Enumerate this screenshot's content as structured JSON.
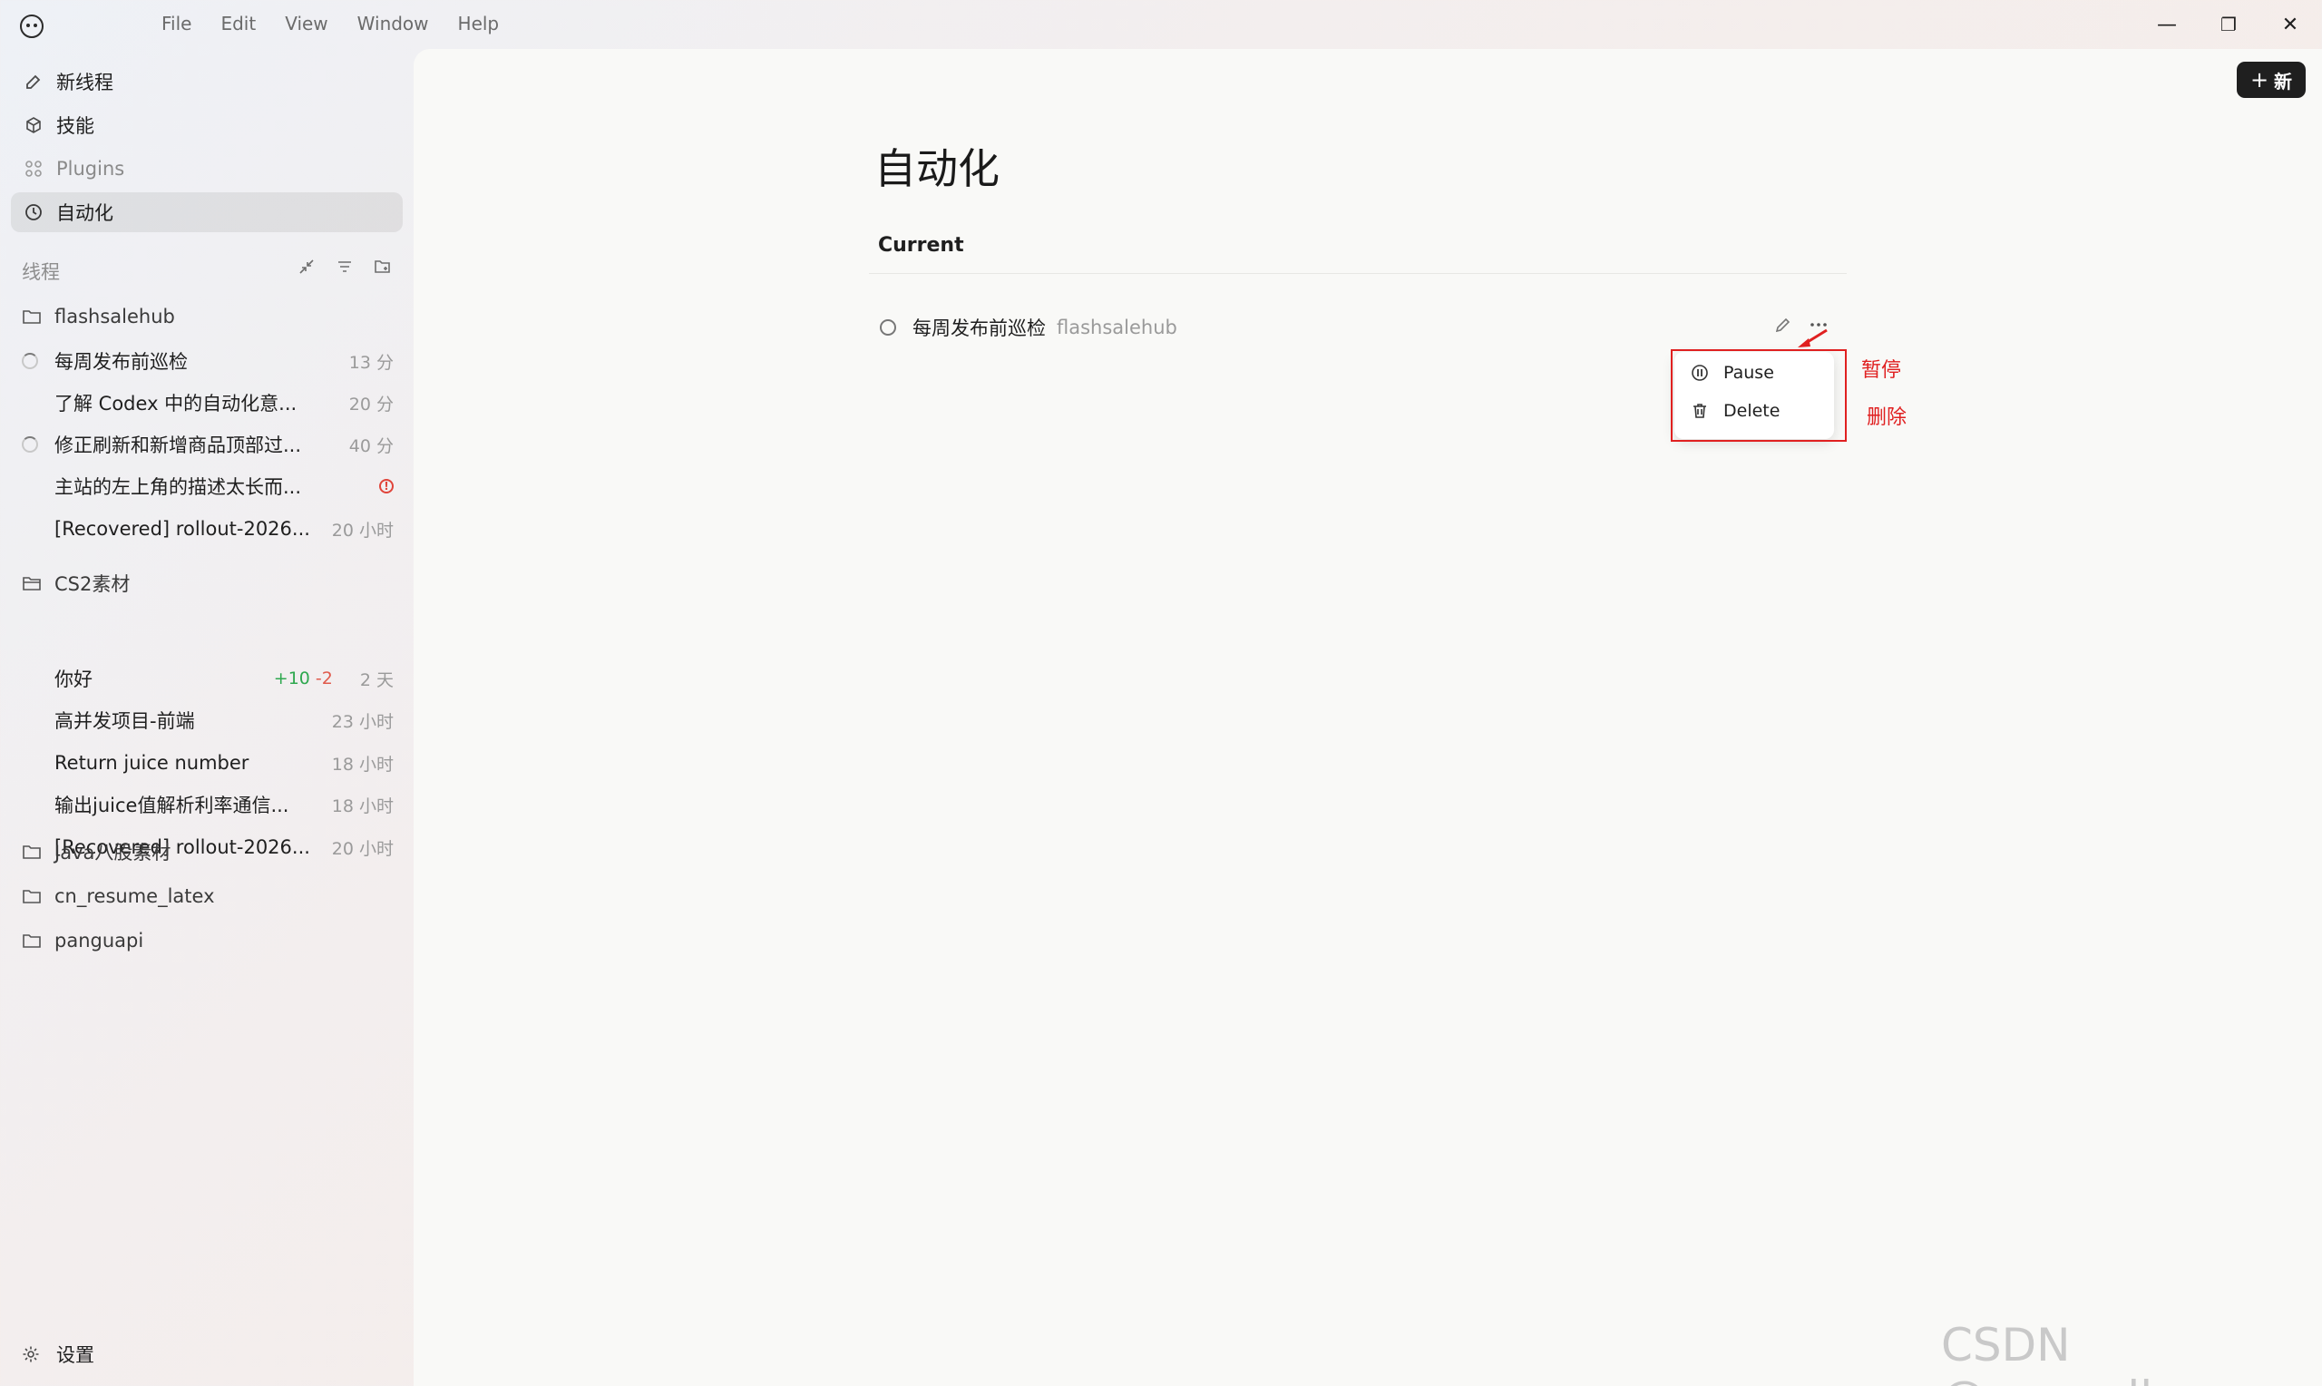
{
  "menu": [
    "File",
    "Edit",
    "View",
    "Window",
    "Help"
  ],
  "window_controls": {
    "minimize": "—",
    "restore": "❐",
    "close": "✕"
  },
  "nav": {
    "new_thread": "新线程",
    "skills": "技能",
    "plugins": "Plugins",
    "automation": "自动化"
  },
  "threads_section": {
    "label": "线程"
  },
  "folders": [
    {
      "name": "flashsalehub",
      "threads": [
        {
          "title": "每周发布前巡检",
          "time": "13 分",
          "lead": "spinner"
        },
        {
          "title": "了解 Codex 中的自动化意...",
          "time": "20 分",
          "lead": ""
        },
        {
          "title": "修正刷新和新增商品顶部过...",
          "time": "40 分",
          "lead": "spinner"
        },
        {
          "title": "主站的左上角的描述太长而...",
          "time": "",
          "lead": "",
          "status": "!"
        },
        {
          "title": "[Recovered] rollout-2026...",
          "time": "20 小时",
          "lead": ""
        }
      ]
    },
    {
      "name": "CS2素材",
      "threads": [
        {
          "title": "你好",
          "time": "2 天",
          "lead": "",
          "added": "+10",
          "removed": "-2"
        },
        {
          "title": "高并发项目-前端",
          "time": "23 小时",
          "lead": ""
        },
        {
          "title": "Return juice number",
          "time": "18 小时",
          "lead": ""
        },
        {
          "title": "输出juice值解析利率通信...",
          "time": "18 小时",
          "lead": ""
        },
        {
          "title": "[Recovered] rollout-2026...",
          "time": "20 小时",
          "lead": ""
        }
      ]
    },
    {
      "name": "Java八股素材"
    },
    {
      "name": "cn_resume_latex"
    },
    {
      "name": "panguapi"
    }
  ],
  "settings_label": "设置",
  "new_button": {
    "icon": "+",
    "label": "新"
  },
  "main": {
    "title": "自动化",
    "section": "Current",
    "automation": {
      "name": "每周发布前巡检",
      "project": "flashsalehub"
    }
  },
  "popup_menu": {
    "pause": "Pause",
    "delete": "Delete"
  },
  "annotations": {
    "pause": "暂停",
    "delete": "删除"
  },
  "watermark": "CSDN @openallzzz",
  "colors": {
    "annotation": "#e02020",
    "added": "#2fa84f",
    "removed": "#e05a4c",
    "error": "#e0443a"
  }
}
